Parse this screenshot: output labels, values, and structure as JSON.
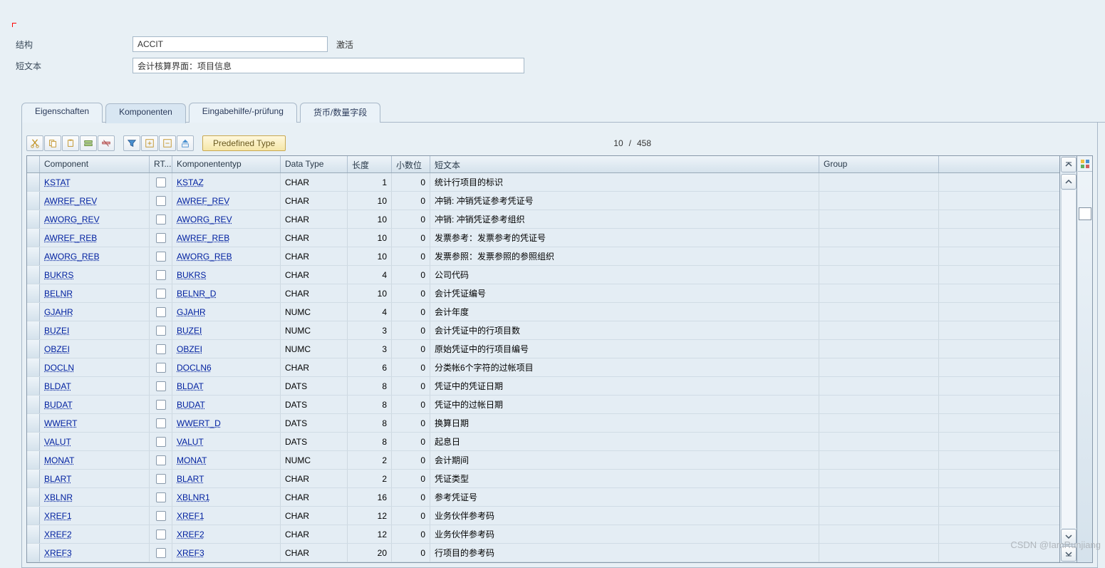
{
  "header": {
    "label_structure": "结构",
    "value_structure": "ACCIT",
    "status": "激活",
    "label_shorttext": "短文本",
    "value_shorttext": "会计核算界面：项目信息"
  },
  "tabs": [
    {
      "label": "Eigenschaften"
    },
    {
      "label": "Komponenten"
    },
    {
      "label": "Eingabehilfe/-prüfung"
    },
    {
      "label": "货币/数量字段"
    }
  ],
  "active_tab_index": 1,
  "toolbar": {
    "predefined_label": "Predefined Type",
    "counter_current": "10",
    "counter_sep": "/",
    "counter_total": "458"
  },
  "columns": {
    "sel": "",
    "component": "Component",
    "rt": "RT...",
    "komptype": "Komponententyp",
    "datatype": "Data Type",
    "length": "长度",
    "decimals": "小数位",
    "shorttext": "短文本",
    "group": "Group"
  },
  "rows": [
    {
      "component": "KSTAT",
      "komptype": "KSTAZ",
      "datatype": "CHAR",
      "length": "1",
      "decimals": "0",
      "shorttext": "统计行项目的标识",
      "group": ""
    },
    {
      "component": "AWREF_REV",
      "komptype": "AWREF_REV",
      "datatype": "CHAR",
      "length": "10",
      "decimals": "0",
      "shorttext": "冲销: 冲销凭证参考凭证号",
      "group": ""
    },
    {
      "component": "AWORG_REV",
      "komptype": "AWORG_REV",
      "datatype": "CHAR",
      "length": "10",
      "decimals": "0",
      "shorttext": "冲销: 冲销凭证参考组织",
      "group": ""
    },
    {
      "component": "AWREF_REB",
      "komptype": "AWREF_REB",
      "datatype": "CHAR",
      "length": "10",
      "decimals": "0",
      "shorttext": "发票参考：发票参考的凭证号",
      "group": ""
    },
    {
      "component": "AWORG_REB",
      "komptype": "AWORG_REB",
      "datatype": "CHAR",
      "length": "10",
      "decimals": "0",
      "shorttext": "发票参照：发票参照的参照组织",
      "group": ""
    },
    {
      "component": "BUKRS",
      "komptype": "BUKRS",
      "datatype": "CHAR",
      "length": "4",
      "decimals": "0",
      "shorttext": "公司代码",
      "group": ""
    },
    {
      "component": "BELNR",
      "komptype": "BELNR_D",
      "datatype": "CHAR",
      "length": "10",
      "decimals": "0",
      "shorttext": "会计凭证编号",
      "group": ""
    },
    {
      "component": "GJAHR",
      "komptype": "GJAHR",
      "datatype": "NUMC",
      "length": "4",
      "decimals": "0",
      "shorttext": "会计年度",
      "group": ""
    },
    {
      "component": "BUZEI",
      "komptype": "BUZEI",
      "datatype": "NUMC",
      "length": "3",
      "decimals": "0",
      "shorttext": "会计凭证中的行项目数",
      "group": ""
    },
    {
      "component": "OBZEI",
      "komptype": "OBZEI",
      "datatype": "NUMC",
      "length": "3",
      "decimals": "0",
      "shorttext": "原始凭证中的行项目编号",
      "group": ""
    },
    {
      "component": "DOCLN",
      "komptype": "DOCLN6",
      "datatype": "CHAR",
      "length": "6",
      "decimals": "0",
      "shorttext": "分类帐6个字符的过帐项目",
      "group": ""
    },
    {
      "component": "BLDAT",
      "komptype": "BLDAT",
      "datatype": "DATS",
      "length": "8",
      "decimals": "0",
      "shorttext": "凭证中的凭证日期",
      "group": ""
    },
    {
      "component": "BUDAT",
      "komptype": "BUDAT",
      "datatype": "DATS",
      "length": "8",
      "decimals": "0",
      "shorttext": "凭证中的过帐日期",
      "group": ""
    },
    {
      "component": "WWERT",
      "komptype": "WWERT_D",
      "datatype": "DATS",
      "length": "8",
      "decimals": "0",
      "shorttext": "换算日期",
      "group": ""
    },
    {
      "component": "VALUT",
      "komptype": "VALUT",
      "datatype": "DATS",
      "length": "8",
      "decimals": "0",
      "shorttext": "起息日",
      "group": ""
    },
    {
      "component": "MONAT",
      "komptype": "MONAT",
      "datatype": "NUMC",
      "length": "2",
      "decimals": "0",
      "shorttext": "会计期间",
      "group": ""
    },
    {
      "component": "BLART",
      "komptype": "BLART",
      "datatype": "CHAR",
      "length": "2",
      "decimals": "0",
      "shorttext": "凭证类型",
      "group": ""
    },
    {
      "component": "XBLNR",
      "komptype": "XBLNR1",
      "datatype": "CHAR",
      "length": "16",
      "decimals": "0",
      "shorttext": "参考凭证号",
      "group": ""
    },
    {
      "component": "XREF1",
      "komptype": "XREF1",
      "datatype": "CHAR",
      "length": "12",
      "decimals": "0",
      "shorttext": "业务伙伴参考码",
      "group": ""
    },
    {
      "component": "XREF2",
      "komptype": "XREF2",
      "datatype": "CHAR",
      "length": "12",
      "decimals": "0",
      "shorttext": "业务伙伴参考码",
      "group": ""
    },
    {
      "component": "XREF3",
      "komptype": "XREF3",
      "datatype": "CHAR",
      "length": "20",
      "decimals": "0",
      "shorttext": "行项目的参考码",
      "group": ""
    }
  ],
  "watermark": "CSDN @IamRunjiang"
}
